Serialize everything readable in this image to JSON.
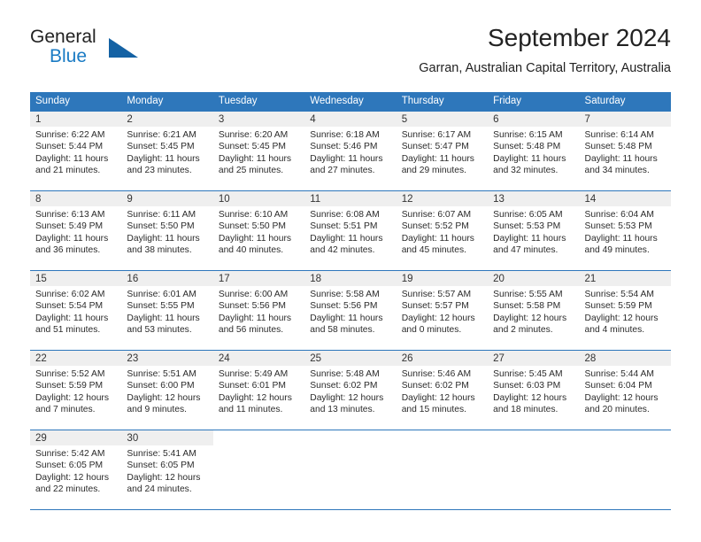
{
  "brand": {
    "name_part1": "General",
    "name_part2": "Blue",
    "flag_icon": "triangle-flag-icon"
  },
  "header": {
    "title": "September 2024",
    "subtitle": "Garran, Australian Capital Territory, Australia"
  },
  "colors": {
    "header_blue": "#2e77bb",
    "brand_blue": "#1a7bc4",
    "flag_blue": "#1462a4",
    "daynum_band": "#efefef",
    "text": "#2b2b2b"
  },
  "weekdays": [
    "Sunday",
    "Monday",
    "Tuesday",
    "Wednesday",
    "Thursday",
    "Friday",
    "Saturday"
  ],
  "labels": {
    "sunrise": "Sunrise:",
    "sunset": "Sunset:",
    "daylight": "Daylight:"
  },
  "weeks": [
    [
      {
        "day": "1",
        "sunrise": "Sunrise: 6:22 AM",
        "sunset": "Sunset: 5:44 PM",
        "daylight1": "Daylight: 11 hours",
        "daylight2": "and 21 minutes."
      },
      {
        "day": "2",
        "sunrise": "Sunrise: 6:21 AM",
        "sunset": "Sunset: 5:45 PM",
        "daylight1": "Daylight: 11 hours",
        "daylight2": "and 23 minutes."
      },
      {
        "day": "3",
        "sunrise": "Sunrise: 6:20 AM",
        "sunset": "Sunset: 5:45 PM",
        "daylight1": "Daylight: 11 hours",
        "daylight2": "and 25 minutes."
      },
      {
        "day": "4",
        "sunrise": "Sunrise: 6:18 AM",
        "sunset": "Sunset: 5:46 PM",
        "daylight1": "Daylight: 11 hours",
        "daylight2": "and 27 minutes."
      },
      {
        "day": "5",
        "sunrise": "Sunrise: 6:17 AM",
        "sunset": "Sunset: 5:47 PM",
        "daylight1": "Daylight: 11 hours",
        "daylight2": "and 29 minutes."
      },
      {
        "day": "6",
        "sunrise": "Sunrise: 6:15 AM",
        "sunset": "Sunset: 5:48 PM",
        "daylight1": "Daylight: 11 hours",
        "daylight2": "and 32 minutes."
      },
      {
        "day": "7",
        "sunrise": "Sunrise: 6:14 AM",
        "sunset": "Sunset: 5:48 PM",
        "daylight1": "Daylight: 11 hours",
        "daylight2": "and 34 minutes."
      }
    ],
    [
      {
        "day": "8",
        "sunrise": "Sunrise: 6:13 AM",
        "sunset": "Sunset: 5:49 PM",
        "daylight1": "Daylight: 11 hours",
        "daylight2": "and 36 minutes."
      },
      {
        "day": "9",
        "sunrise": "Sunrise: 6:11 AM",
        "sunset": "Sunset: 5:50 PM",
        "daylight1": "Daylight: 11 hours",
        "daylight2": "and 38 minutes."
      },
      {
        "day": "10",
        "sunrise": "Sunrise: 6:10 AM",
        "sunset": "Sunset: 5:50 PM",
        "daylight1": "Daylight: 11 hours",
        "daylight2": "and 40 minutes."
      },
      {
        "day": "11",
        "sunrise": "Sunrise: 6:08 AM",
        "sunset": "Sunset: 5:51 PM",
        "daylight1": "Daylight: 11 hours",
        "daylight2": "and 42 minutes."
      },
      {
        "day": "12",
        "sunrise": "Sunrise: 6:07 AM",
        "sunset": "Sunset: 5:52 PM",
        "daylight1": "Daylight: 11 hours",
        "daylight2": "and 45 minutes."
      },
      {
        "day": "13",
        "sunrise": "Sunrise: 6:05 AM",
        "sunset": "Sunset: 5:53 PM",
        "daylight1": "Daylight: 11 hours",
        "daylight2": "and 47 minutes."
      },
      {
        "day": "14",
        "sunrise": "Sunrise: 6:04 AM",
        "sunset": "Sunset: 5:53 PM",
        "daylight1": "Daylight: 11 hours",
        "daylight2": "and 49 minutes."
      }
    ],
    [
      {
        "day": "15",
        "sunrise": "Sunrise: 6:02 AM",
        "sunset": "Sunset: 5:54 PM",
        "daylight1": "Daylight: 11 hours",
        "daylight2": "and 51 minutes."
      },
      {
        "day": "16",
        "sunrise": "Sunrise: 6:01 AM",
        "sunset": "Sunset: 5:55 PM",
        "daylight1": "Daylight: 11 hours",
        "daylight2": "and 53 minutes."
      },
      {
        "day": "17",
        "sunrise": "Sunrise: 6:00 AM",
        "sunset": "Sunset: 5:56 PM",
        "daylight1": "Daylight: 11 hours",
        "daylight2": "and 56 minutes."
      },
      {
        "day": "18",
        "sunrise": "Sunrise: 5:58 AM",
        "sunset": "Sunset: 5:56 PM",
        "daylight1": "Daylight: 11 hours",
        "daylight2": "and 58 minutes."
      },
      {
        "day": "19",
        "sunrise": "Sunrise: 5:57 AM",
        "sunset": "Sunset: 5:57 PM",
        "daylight1": "Daylight: 12 hours",
        "daylight2": "and 0 minutes."
      },
      {
        "day": "20",
        "sunrise": "Sunrise: 5:55 AM",
        "sunset": "Sunset: 5:58 PM",
        "daylight1": "Daylight: 12 hours",
        "daylight2": "and 2 minutes."
      },
      {
        "day": "21",
        "sunrise": "Sunrise: 5:54 AM",
        "sunset": "Sunset: 5:59 PM",
        "daylight1": "Daylight: 12 hours",
        "daylight2": "and 4 minutes."
      }
    ],
    [
      {
        "day": "22",
        "sunrise": "Sunrise: 5:52 AM",
        "sunset": "Sunset: 5:59 PM",
        "daylight1": "Daylight: 12 hours",
        "daylight2": "and 7 minutes."
      },
      {
        "day": "23",
        "sunrise": "Sunrise: 5:51 AM",
        "sunset": "Sunset: 6:00 PM",
        "daylight1": "Daylight: 12 hours",
        "daylight2": "and 9 minutes."
      },
      {
        "day": "24",
        "sunrise": "Sunrise: 5:49 AM",
        "sunset": "Sunset: 6:01 PM",
        "daylight1": "Daylight: 12 hours",
        "daylight2": "and 11 minutes."
      },
      {
        "day": "25",
        "sunrise": "Sunrise: 5:48 AM",
        "sunset": "Sunset: 6:02 PM",
        "daylight1": "Daylight: 12 hours",
        "daylight2": "and 13 minutes."
      },
      {
        "day": "26",
        "sunrise": "Sunrise: 5:46 AM",
        "sunset": "Sunset: 6:02 PM",
        "daylight1": "Daylight: 12 hours",
        "daylight2": "and 15 minutes."
      },
      {
        "day": "27",
        "sunrise": "Sunrise: 5:45 AM",
        "sunset": "Sunset: 6:03 PM",
        "daylight1": "Daylight: 12 hours",
        "daylight2": "and 18 minutes."
      },
      {
        "day": "28",
        "sunrise": "Sunrise: 5:44 AM",
        "sunset": "Sunset: 6:04 PM",
        "daylight1": "Daylight: 12 hours",
        "daylight2": "and 20 minutes."
      }
    ],
    [
      {
        "day": "29",
        "sunrise": "Sunrise: 5:42 AM",
        "sunset": "Sunset: 6:05 PM",
        "daylight1": "Daylight: 12 hours",
        "daylight2": "and 22 minutes."
      },
      {
        "day": "30",
        "sunrise": "Sunrise: 5:41 AM",
        "sunset": "Sunset: 6:05 PM",
        "daylight1": "Daylight: 12 hours",
        "daylight2": "and 24 minutes."
      },
      {
        "day": "",
        "sunrise": "",
        "sunset": "",
        "daylight1": "",
        "daylight2": ""
      },
      {
        "day": "",
        "sunrise": "",
        "sunset": "",
        "daylight1": "",
        "daylight2": ""
      },
      {
        "day": "",
        "sunrise": "",
        "sunset": "",
        "daylight1": "",
        "daylight2": ""
      },
      {
        "day": "",
        "sunrise": "",
        "sunset": "",
        "daylight1": "",
        "daylight2": ""
      },
      {
        "day": "",
        "sunrise": "",
        "sunset": "",
        "daylight1": "",
        "daylight2": ""
      }
    ]
  ]
}
